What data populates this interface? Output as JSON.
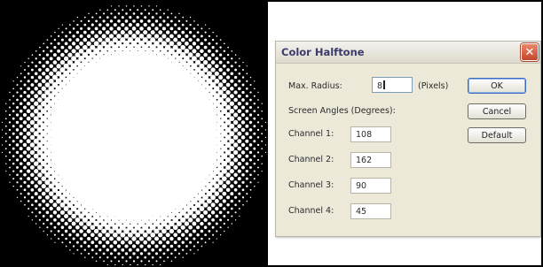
{
  "dialog": {
    "title": "Color Halftone",
    "close_glyph": "✕",
    "max_radius_label": "Max. Radius:",
    "max_radius_value": "8",
    "pixels_unit": "(Pixels)",
    "screen_angles_label": "Screen Angles (Degrees):",
    "channels": [
      {
        "label": "Channel 1:",
        "value": "108"
      },
      {
        "label": "Channel 2:",
        "value": "162"
      },
      {
        "label": "Channel 3:",
        "value": "90"
      },
      {
        "label": "Channel 4:",
        "value": "45"
      }
    ],
    "buttons": {
      "ok": "OK",
      "cancel": "Cancel",
      "default": "Default"
    }
  },
  "preview": {
    "background_color": "#000000",
    "dot_color": "#ffffff",
    "description_icon": "halftone-dot-pattern"
  }
}
